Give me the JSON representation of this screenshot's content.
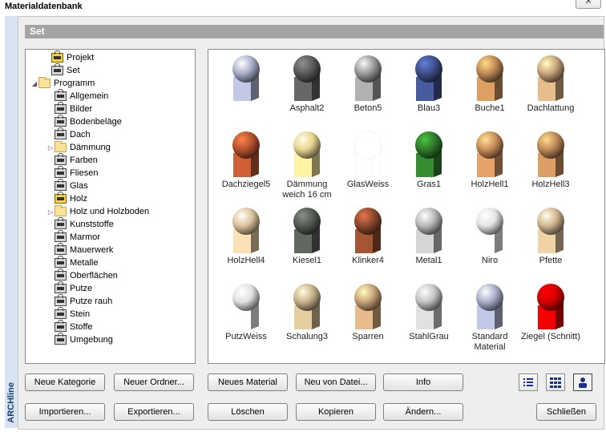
{
  "window": {
    "title": "Materialdatenbank",
    "close_label": "✕",
    "side_label": "ARCHline"
  },
  "header": {
    "set_label": "Set"
  },
  "tree": [
    {
      "label": "Projekt",
      "icon": "lock-yellow",
      "indent": 1,
      "expander": ""
    },
    {
      "label": "Set",
      "icon": "lock",
      "indent": 1,
      "expander": ""
    },
    {
      "label": "Programm",
      "icon": "folder",
      "indent": 0,
      "expander": "◢"
    },
    {
      "label": "Allgemein",
      "icon": "lock",
      "indent": 2,
      "expander": ""
    },
    {
      "label": "Bilder",
      "icon": "lock",
      "indent": 2,
      "expander": ""
    },
    {
      "label": "Bodenbeläge",
      "icon": "lock",
      "indent": 2,
      "expander": ""
    },
    {
      "label": "Dach",
      "icon": "lock",
      "indent": 2,
      "expander": ""
    },
    {
      "label": "Dämmung",
      "icon": "folder",
      "indent": 2,
      "expander": "▷"
    },
    {
      "label": "Farben",
      "icon": "lock",
      "indent": 2,
      "expander": ""
    },
    {
      "label": "Fliesen",
      "icon": "lock",
      "indent": 2,
      "expander": ""
    },
    {
      "label": "Glas",
      "icon": "lock",
      "indent": 2,
      "expander": ""
    },
    {
      "label": "Holz",
      "icon": "lock-yellow",
      "indent": 2,
      "expander": ""
    },
    {
      "label": "Holz und Holzboden",
      "icon": "folder",
      "indent": 2,
      "expander": "▷"
    },
    {
      "label": "Kunststoffe",
      "icon": "lock",
      "indent": 2,
      "expander": ""
    },
    {
      "label": "Marmor",
      "icon": "lock",
      "indent": 2,
      "expander": ""
    },
    {
      "label": "Mauerwerk",
      "icon": "lock",
      "indent": 2,
      "expander": ""
    },
    {
      "label": "Metalle",
      "icon": "lock",
      "indent": 2,
      "expander": ""
    },
    {
      "label": "Oberflächen",
      "icon": "lock",
      "indent": 2,
      "expander": ""
    },
    {
      "label": "Putze",
      "icon": "lock",
      "indent": 2,
      "expander": ""
    },
    {
      "label": "Putze rauh",
      "icon": "lock",
      "indent": 2,
      "expander": ""
    },
    {
      "label": "Stein",
      "icon": "lock",
      "indent": 2,
      "expander": ""
    },
    {
      "label": "Stoffe",
      "icon": "lock",
      "indent": 2,
      "expander": ""
    },
    {
      "label": "Umgebung",
      "icon": "lock",
      "indent": 2,
      "expander": ""
    }
  ],
  "materials": [
    {
      "label": "",
      "color": "#a9afc9"
    },
    {
      "label": "Asphalt2",
      "color": "#5a5a5a"
    },
    {
      "label": "Beton5",
      "color": "#9b9b9b"
    },
    {
      "label": "Blau3",
      "color": "#3e4f8a"
    },
    {
      "label": "Buche1",
      "color": "#c08a55"
    },
    {
      "label": "Dachlattung",
      "color": "#c9a47a"
    },
    {
      "label": "Dachziegel5",
      "color": "#b4532d"
    },
    {
      "label": "Dämmung weich 16 cm",
      "color": "#e7d48f"
    },
    {
      "label": "GlasWeiss",
      "color": "#ffffff"
    },
    {
      "label": "Gras1",
      "color": "#2f7a2a"
    },
    {
      "label": "HolzHell1",
      "color": "#c98d5c"
    },
    {
      "label": "HolzHell3",
      "color": "#c08a58"
    },
    {
      "label": "HolzHell4",
      "color": "#dcc49e"
    },
    {
      "label": "Kiesel1",
      "color": "#555a55"
    },
    {
      "label": "Klinker4",
      "color": "#8e4a2e"
    },
    {
      "label": "Metal1",
      "color": "#b9b9b9"
    },
    {
      "label": "Niro",
      "color": "#e4e4e4"
    },
    {
      "label": "Pfette",
      "color": "#d1b791"
    },
    {
      "label": "PutzWeiss",
      "color": "#e2e2e2"
    },
    {
      "label": "Schalung3",
      "color": "#c9b38c"
    },
    {
      "label": "Sparren",
      "color": "#c9a37a"
    },
    {
      "label": "StahlGrau",
      "color": "#c4c4c4"
    },
    {
      "label": "Standard Material",
      "color": "#a9afc9"
    },
    {
      "label": "Ziegel (Schnitt)",
      "color": "#d40000"
    }
  ],
  "buttons": {
    "neue_kategorie": "Neue Kategorie",
    "neuer_ordner": "Neuer Ordner...",
    "neues_material": "Neues Material",
    "neu_von_datei": "Neu von Datei...",
    "info": "Info",
    "importieren": "Importieren...",
    "exportieren": "Exportieren...",
    "loeschen": "Löschen",
    "kopieren": "Kopieren",
    "aendern": "Ändern...",
    "schliessen": "Schließen"
  },
  "view_modes": [
    {
      "name": "list-view-icon"
    },
    {
      "name": "grid-view-icon"
    },
    {
      "name": "user-view-icon"
    }
  ]
}
